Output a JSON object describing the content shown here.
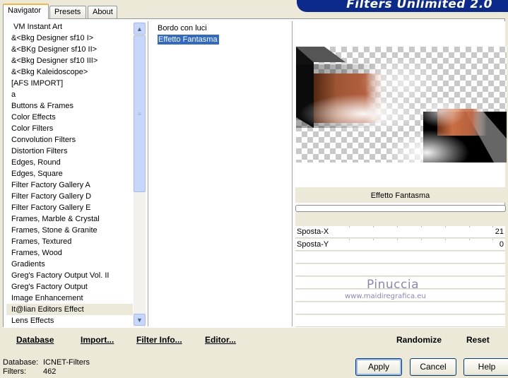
{
  "app": {
    "title": "Filters Unlimited 2.0"
  },
  "tabs": [
    {
      "label": "Navigator",
      "active": true
    },
    {
      "label": "Presets",
      "active": false
    },
    {
      "label": "About",
      "active": false
    }
  ],
  "categories": [
    "VM Instant Art",
    "&<Bkg Designer sf10 I>",
    "&<BKg Designer sf10 II>",
    "&<Bkg Designer sf10 III>",
    "&<Bkg Kaleidoscope>",
    "[AFS IMPORT]",
    "a",
    "Buttons & Frames",
    "Color Effects",
    "Color Filters",
    "Convolution Filters",
    "Distortion Filters",
    "Edges, Round",
    "Edges, Square",
    "Filter Factory Gallery A",
    "Filter Factory Gallery D",
    "Filter Factory Gallery E",
    "Frames, Marble & Crystal",
    "Frames, Stone & Granite",
    "Frames, Textured",
    "Frames, Wood",
    "Gradients",
    "Greg's Factory Output Vol. II",
    "Greg's Factory Output",
    "Image Enhancement",
    "It@lian Editors Effect",
    "Lens Effects"
  ],
  "selected_category": "It@lian Editors Effect",
  "filters": [
    "Bordo con luci",
    "Effetto Fantasma"
  ],
  "selected_filter": "Effetto Fantasma",
  "preview": {
    "effect_name": "Effetto Fantasma"
  },
  "params": [
    {
      "label": "Sposta-X",
      "value": "21"
    },
    {
      "label": "Sposta-Y",
      "value": "0"
    }
  ],
  "watermark": {
    "name": "Pinuccia",
    "url": "www.maidiregrafica.eu"
  },
  "toolbar": {
    "database": "Database",
    "import": "Import...",
    "filter_info": "Filter Info...",
    "editor": "Editor...",
    "randomize": "Randomize",
    "reset": "Reset"
  },
  "status": {
    "database_label": "Database:",
    "database_value": "ICNET-Filters",
    "filters_label": "Filters:",
    "filters_value": "462"
  },
  "buttons": {
    "apply": "Apply",
    "cancel": "Cancel",
    "help": "Help"
  },
  "colors": {
    "banner": "#0b2a8c",
    "selection": "#316ac5",
    "accent_tab": "#f9b53d"
  }
}
